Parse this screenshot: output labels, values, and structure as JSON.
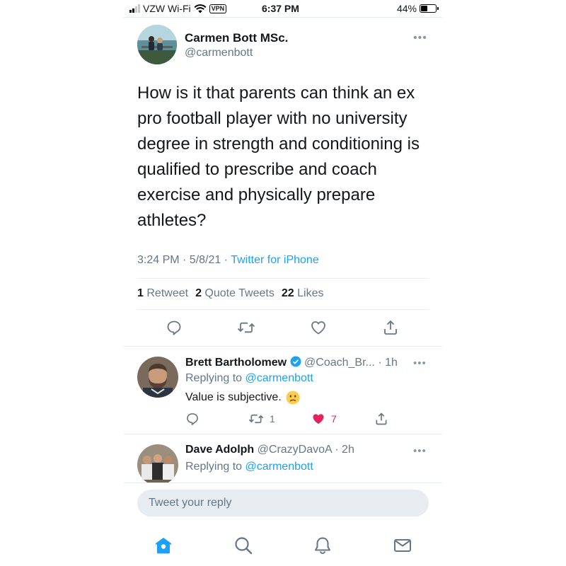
{
  "status_bar": {
    "carrier": "VZW Wi-Fi",
    "vpn": "VPN",
    "time": "6:37 PM",
    "battery_percent": "44%",
    "battery_level": 0.44,
    "signal_bars": 2
  },
  "tweet": {
    "author_name": "Carmen Bott MSc.",
    "author_handle": "@carmenbott",
    "more_icon": "more-horizontal-icon",
    "text": "How is it that parents can think an ex pro football player with no university degree in strength and conditioning is qualified to prescribe and coach exercise and physically prepare athletes?",
    "time": "3:24 PM · 5/8/21 · ",
    "source": "Twitter for iPhone",
    "stats": {
      "retweets_count": "1",
      "retweets_label": "Retweet",
      "quote_count": "2",
      "quote_label": "Quote Tweets",
      "likes_count": "22",
      "likes_label": "Likes"
    },
    "actions": [
      "reply-icon",
      "retweet-icon",
      "like-icon",
      "share-icon"
    ]
  },
  "replies": [
    {
      "name": "Brett Bartholomew",
      "verified": true,
      "handle_time": "@Coach_Br... · 1h",
      "replying_prefix": "Replying to ",
      "replying_to": "@carmenbott",
      "text": "Value is subjective.",
      "emoji": "confused-face",
      "retweets": "1",
      "likes": "7",
      "liked": true
    },
    {
      "name": "Dave Adolph",
      "verified": false,
      "handle_time": "@CrazyDavoA · 2h",
      "replying_prefix": "Replying to ",
      "replying_to": "@carmenbott"
    }
  ],
  "reply_input": {
    "placeholder": "Tweet your reply"
  },
  "tabbar": [
    "home-icon",
    "search-icon",
    "notifications-icon",
    "messages-icon"
  ],
  "colors": {
    "accent": "#1da1f2",
    "secondary_text": "#657786",
    "like": "#e0245e",
    "divider": "#e6ecf0"
  }
}
